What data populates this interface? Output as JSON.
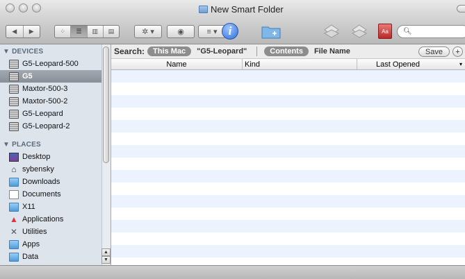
{
  "window": {
    "title": "New Smart Folder"
  },
  "toolbar": {
    "back_glyph": "◀",
    "forward_glyph": "▶",
    "view_icons_glyph": "⁘",
    "view_list_glyph": "☰",
    "view_columns_glyph": "▥",
    "view_coverflow_glyph": "▤",
    "action_glyph": "✲ ▾",
    "quicklook_glyph": "◉",
    "arrange_glyph": "≡ ▾",
    "info_glyph": "i",
    "dictionary_glyph": "Aa",
    "search_glyph": "🔍︎",
    "search_value": ""
  },
  "sidebar": {
    "devices_header": "▼ DEVICES",
    "places_header": "▼ PLACES",
    "devices": [
      {
        "label": "G5-Leopard-500",
        "icon": "hard-disk-icon",
        "selected": false
      },
      {
        "label": "G5",
        "icon": "hard-disk-icon",
        "selected": true
      },
      {
        "label": "Maxtor-500-3",
        "icon": "hard-disk-icon",
        "selected": false
      },
      {
        "label": "Maxtor-500-2",
        "icon": "hard-disk-icon",
        "selected": false
      },
      {
        "label": "G5-Leopard",
        "icon": "hard-disk-icon",
        "selected": false
      },
      {
        "label": "G5-Leopard-2",
        "icon": "hard-disk-icon",
        "selected": false
      }
    ],
    "places": [
      {
        "label": "Desktop",
        "icon": "desktop-icon"
      },
      {
        "label": "sybensky",
        "icon": "home-icon"
      },
      {
        "label": "Downloads",
        "icon": "folder-icon"
      },
      {
        "label": "Documents",
        "icon": "document-folder-icon"
      },
      {
        "label": "X11",
        "icon": "folder-icon"
      },
      {
        "label": "Applications",
        "icon": "applications-icon"
      },
      {
        "label": "Utilities",
        "icon": "utilities-icon"
      },
      {
        "label": "Apps",
        "icon": "folder-icon"
      },
      {
        "label": "Data",
        "icon": "folder-icon"
      }
    ],
    "scroll_up_glyph": "▲",
    "scroll_down_glyph": "▼"
  },
  "search_bar": {
    "label": "Search:",
    "scope_this_mac": "This Mac",
    "scope_volume": "\"G5-Leopard\"",
    "attr_contents": "Contents",
    "attr_file_name": "File Name",
    "save_label": "Save",
    "add_glyph": "+"
  },
  "list": {
    "columns": [
      "Name",
      "Kind",
      "Last Opened"
    ],
    "sort_glyph": "▾",
    "empty_row_count": 16
  },
  "colors": {
    "sidebar_bg": "#dde4ec",
    "row_stripe": "#edf3fe",
    "selection": "#8a9099"
  }
}
